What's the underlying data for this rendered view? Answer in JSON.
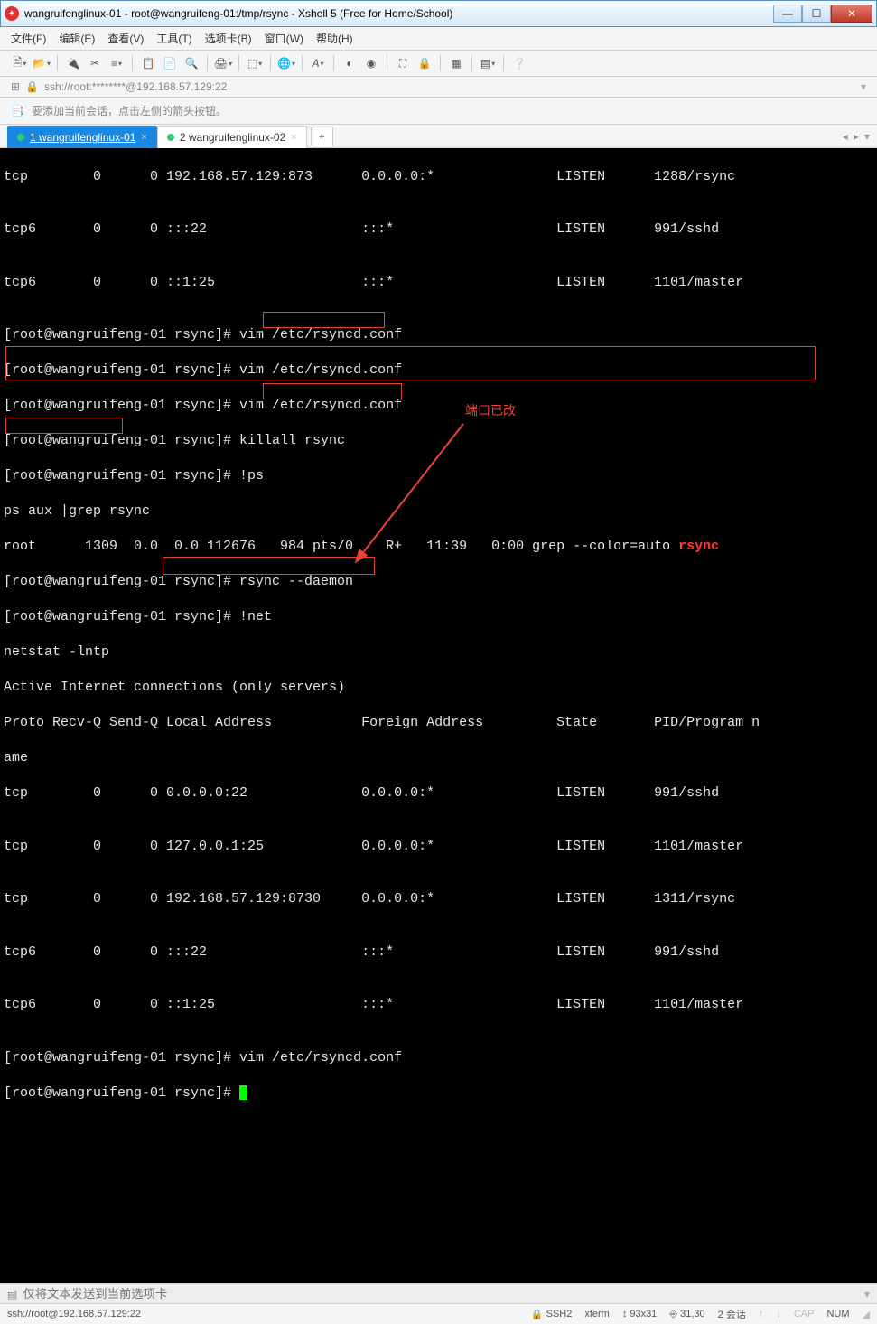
{
  "window": {
    "title": "wangruifenglinux-01 - root@wangruifeng-01:/tmp/rsync - Xshell 5 (Free for Home/School)"
  },
  "menu": {
    "file": "文件(F)",
    "edit": "编辑(E)",
    "view": "查看(V)",
    "tools": "工具(T)",
    "tabs": "选项卡(B)",
    "window": "窗口(W)",
    "help": "帮助(H)"
  },
  "address": {
    "text": "ssh://root:********@192.168.57.129:22"
  },
  "infobar": {
    "text": "要添加当前会话，点击左侧的箭头按钮。"
  },
  "tabs": {
    "t1": "1 wangruifenglinux-01",
    "t2": "2 wangruifenglinux-02"
  },
  "term": {
    "l01": "tcp        0      0 192.168.57.129:873      0.0.0.0:*               LISTEN      1288/rsync",
    "l02": "",
    "l03": "tcp6       0      0 :::22                   :::*                    LISTEN      991/sshd",
    "l04": "",
    "l05": "tcp6       0      0 ::1:25                  :::*                    LISTEN      1101/master",
    "l06": "",
    "l07": "[root@wangruifeng-01 rsync]# vim /etc/rsyncd.conf",
    "l08": "[root@wangruifeng-01 rsync]# vim /etc/rsyncd.conf",
    "l09": "[root@wangruifeng-01 rsync]# vim /etc/rsyncd.conf",
    "l10": "[root@wangruifeng-01 rsync]# killall rsync",
    "l11": "[root@wangruifeng-01 rsync]# !ps",
    "l12": "ps aux |grep rsync",
    "l13a": "root      1309  0.0  0.0 112676   984 pts/0    R+   11:39   0:00 grep --color=auto ",
    "l13b": "rsync",
    "l14": "[root@wangruifeng-01 rsync]# rsync --daemon",
    "l15": "[root@wangruifeng-01 rsync]# !net",
    "l16": "netstat -lntp",
    "l17": "Active Internet connections (only servers)",
    "l18": "Proto Recv-Q Send-Q Local Address           Foreign Address         State       PID/Program n",
    "l18b": "ame",
    "l19": "tcp        0      0 0.0.0.0:22              0.0.0.0:*               LISTEN      991/sshd",
    "l20": "",
    "l21": "tcp        0      0 127.0.0.1:25            0.0.0.0:*               LISTEN      1101/master",
    "l22": "",
    "l23": "tcp        0      0 192.168.57.129:8730     0.0.0.0:*               LISTEN      1311/rsync",
    "l24": "",
    "l25": "tcp6       0      0 :::22                   :::*                    LISTEN      991/sshd",
    "l26": "",
    "l27": "tcp6       0      0 ::1:25                  :::*                    LISTEN      1101/master",
    "l28": "",
    "l29": "[root@wangruifeng-01 rsync]# vim /etc/rsyncd.conf",
    "l30": "[root@wangruifeng-01 rsync]# "
  },
  "annotation": {
    "port_changed": "端口已改"
  },
  "sendbar": {
    "placeholder": "仅将文本发送到当前选项卡"
  },
  "status": {
    "conn": "ssh://root@192.168.57.129:22",
    "ssh2": "SSH2",
    "term": "xterm",
    "size": "93x31",
    "pos": "31,30",
    "sessions": "2 会话",
    "cap": "CAP",
    "num": "NUM"
  }
}
